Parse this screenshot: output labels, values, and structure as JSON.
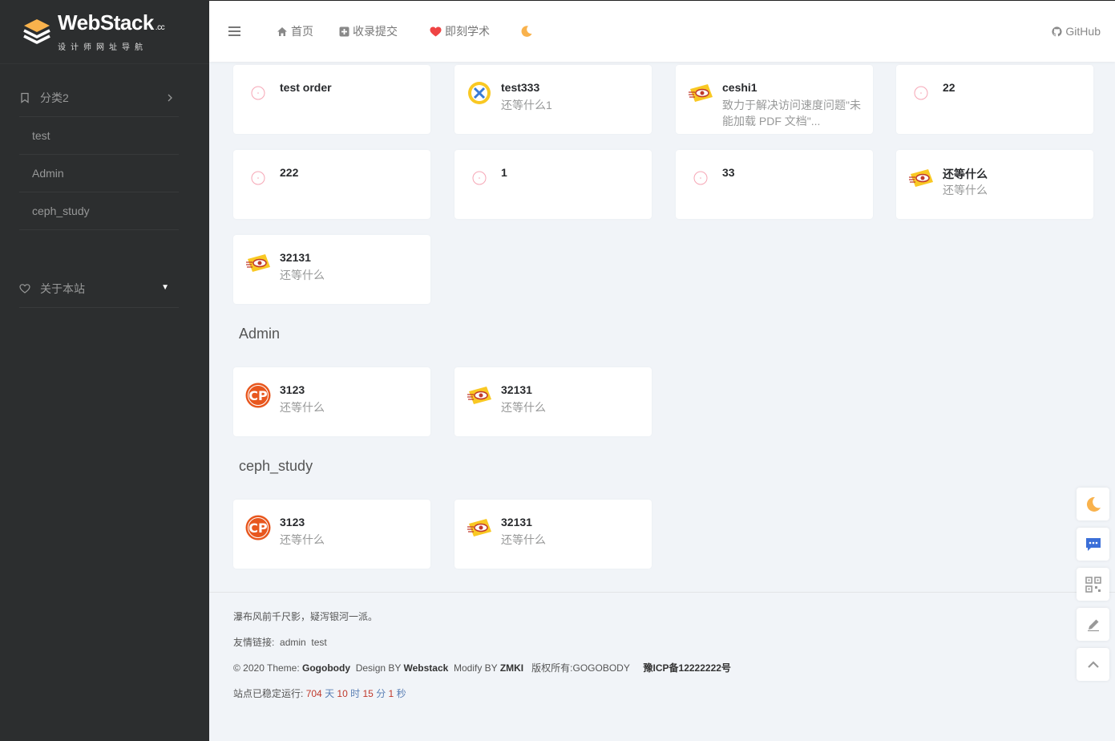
{
  "logo": {
    "title": "WebStack",
    "suffix": ".cc",
    "subtitle": "设计师网址导航"
  },
  "sidebar": {
    "category": "分类2",
    "subitems": [
      "test",
      "Admin",
      "ceph_study"
    ],
    "about": "关于本站"
  },
  "topbar": {
    "home": "首页",
    "submit": "收录提交",
    "academic": "即刻学术",
    "github": "GitHub"
  },
  "cards": [
    {
      "title": "test order",
      "desc": "",
      "icon": "placeholder-icon"
    },
    {
      "title": "test333",
      "desc": "还等什么1",
      "icon": "tools-icon"
    },
    {
      "title": "ceshi1",
      "desc": "致力于解决访问速度问题\"未能加载 PDF 文档\"...",
      "icon": "eye-logo-icon"
    },
    {
      "title": "22",
      "desc": "",
      "icon": "placeholder-icon"
    },
    {
      "title": "222",
      "desc": "",
      "icon": "placeholder-icon"
    },
    {
      "title": "1",
      "desc": "",
      "icon": "placeholder-icon"
    },
    {
      "title": "33",
      "desc": "",
      "icon": "placeholder-icon"
    },
    {
      "title": "还等什么",
      "desc": "还等什么",
      "icon": "eye-logo-icon"
    },
    {
      "title": "32131",
      "desc": "还等什么",
      "icon": "eye-logo-icon"
    }
  ],
  "sections": [
    {
      "title": "Admin",
      "cards": [
        {
          "title": "3123",
          "desc": "还等什么",
          "icon": "cp-logo-icon"
        },
        {
          "title": "32131",
          "desc": "还等什么",
          "icon": "eye-logo-icon"
        }
      ]
    },
    {
      "title": "ceph_study",
      "cards": [
        {
          "title": "3123",
          "desc": "还等什么",
          "icon": "cp-logo-icon"
        },
        {
          "title": "32131",
          "desc": "还等什么",
          "icon": "eye-logo-icon"
        }
      ]
    }
  ],
  "footer": {
    "quote": "瀑布风前千尺影，疑泻银河一派。",
    "friends_label": "友情链接:",
    "friends": [
      "admin",
      "test"
    ],
    "copyright_prefix": "© 2020 Theme:",
    "theme": "Gogobody",
    "design_prefix": "Design BY",
    "design": "Webstack",
    "modify_prefix": "Modify BY",
    "modify": "ZMKI",
    "rights_prefix": "版权所有:",
    "rights": "GOGOBODY",
    "icp": "豫ICP备12222222号",
    "uptime_label": "站点已稳定运行:",
    "uptime": {
      "days": "704",
      "day_unit": "天",
      "hours": "10",
      "hour_unit": "时",
      "minutes": "15",
      "minute_unit": "分",
      "seconds": "1",
      "second_unit": "秒"
    }
  },
  "colors": {
    "sidebar_bg": "#2c2e2f",
    "accent_orange": "#f9b24c",
    "heart_red": "#ef4444",
    "float_blue": "#3b6fd8"
  }
}
